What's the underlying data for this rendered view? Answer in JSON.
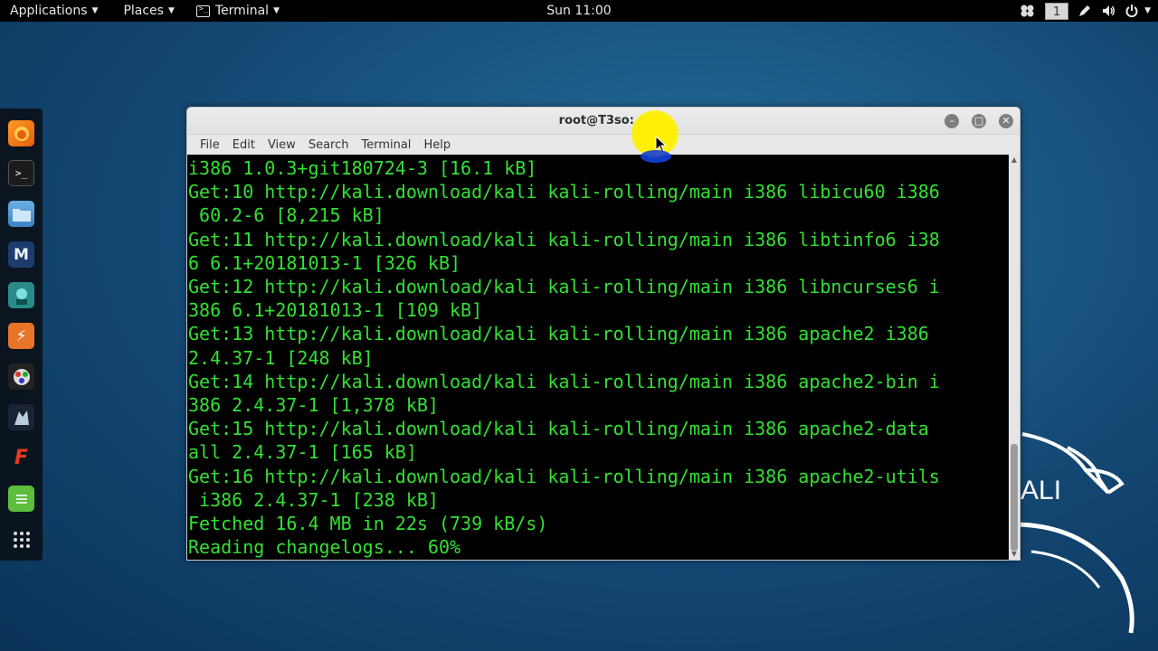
{
  "top_panel": {
    "applications": "Applications",
    "places": "Places",
    "terminal": "Terminal",
    "clock": "Sun 11:00",
    "workspace": "1",
    "tray_icons": [
      "apps-cluster-icon",
      "pen-icon",
      "volume-icon",
      "power-icon"
    ]
  },
  "dock": {
    "items": [
      "firefox-icon",
      "terminal-icon",
      "files-icon",
      "metasploit-icon",
      "armitage-icon",
      "burpsuite-icon",
      "maltego-icon",
      "beef-icon",
      "faraday-icon",
      "notes-icon",
      "show-apps-icon"
    ]
  },
  "window": {
    "title": "root@T3so: ~",
    "menu": [
      "File",
      "Edit",
      "View",
      "Search",
      "Terminal",
      "Help"
    ],
    "lines": [
      "i386 1.0.3+git180724-3 [16.1 kB]",
      "Get:10 http://kali.download/kali kali-rolling/main i386 libicu60 i386",
      " 60.2-6 [8,215 kB]",
      "Get:11 http://kali.download/kali kali-rolling/main i386 libtinfo6 i38",
      "6 6.1+20181013-1 [326 kB]",
      "Get:12 http://kali.download/kali kali-rolling/main i386 libncurses6 i",
      "386 6.1+20181013-1 [109 kB]",
      "Get:13 http://kali.download/kali kali-rolling/main i386 apache2 i386",
      "2.4.37-1 [248 kB]",
      "Get:14 http://kali.download/kali kali-rolling/main i386 apache2-bin i",
      "386 2.4.37-1 [1,378 kB]",
      "Get:15 http://kali.download/kali kali-rolling/main i386 apache2-data",
      "all 2.4.37-1 [165 kB]",
      "Get:16 http://kali.download/kali kali-rolling/main i386 apache2-utils",
      " i386 2.4.37-1 [238 kB]",
      "Fetched 16.4 MB in 22s (739 kB/s)",
      "Reading changelogs... 60%"
    ]
  },
  "colors": {
    "terminal_text": "#33e033",
    "terminal_bg": "#000000",
    "highlight": "#fff000"
  },
  "watermark": "ALI"
}
